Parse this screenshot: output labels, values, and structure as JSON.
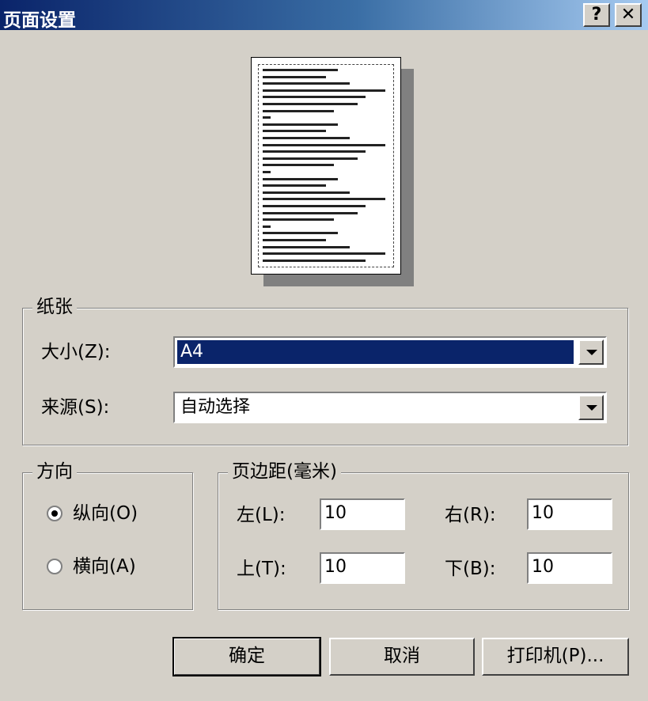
{
  "window": {
    "title": "页面设置",
    "help_label": "?",
    "close_label": "✕"
  },
  "paper": {
    "group_title": "纸张",
    "size_label": "大小(Z):",
    "size_value": "A4",
    "source_label": "来源(S):",
    "source_value": "自动选择"
  },
  "orientation": {
    "group_title": "方向",
    "portrait_label": "纵向(O)",
    "landscape_label": "横向(A)",
    "selected": "portrait"
  },
  "margins": {
    "group_title": "页边距(毫米)",
    "left_label": "左(L):",
    "left_value": "10",
    "right_label": "右(R):",
    "right_value": "10",
    "top_label": "上(T):",
    "top_value": "10",
    "bottom_label": "下(B):",
    "bottom_value": "10"
  },
  "buttons": {
    "ok": "确定",
    "cancel": "取消",
    "printer": "打印机(P)..."
  },
  "colors": {
    "dialog_bg": "#d4d0c8",
    "title_bar": "#0a246a",
    "selection": "#0a246a"
  }
}
